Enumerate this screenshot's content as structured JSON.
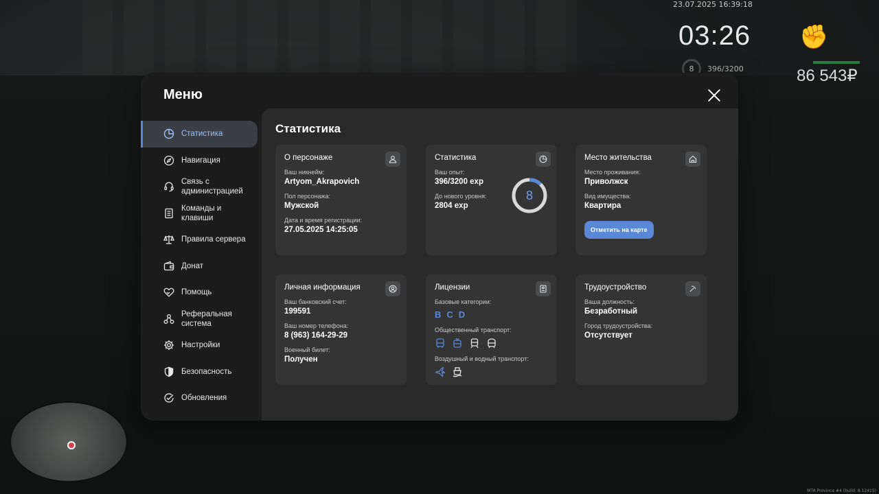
{
  "hud": {
    "datetime": "23.07.2025 16:39:18",
    "clock": "03:26",
    "level": "8",
    "exp": "396/3200",
    "money": "86 543₽",
    "build": "MTA Province #4 (build: 8.12415)"
  },
  "menu": {
    "title": "Меню",
    "sidebar": [
      {
        "label": "Статистика",
        "icon": "pie-chart-icon",
        "active": true
      },
      {
        "label": "Навигация",
        "icon": "compass-icon"
      },
      {
        "label": "Связь с администрацией",
        "icon": "headset-icon"
      },
      {
        "label": "Команды и клавиши",
        "icon": "document-icon"
      },
      {
        "label": "Правила сервера",
        "icon": "scales-icon"
      },
      {
        "label": "Донат",
        "icon": "wallet-icon"
      },
      {
        "label": "Помощь",
        "icon": "handshake-heart-icon"
      },
      {
        "label": "Реферальная система",
        "icon": "network-icon"
      },
      {
        "label": "Настройки",
        "icon": "gear-icon"
      },
      {
        "label": "Безопасность",
        "icon": "shield-icon"
      },
      {
        "label": "Обновления",
        "icon": "check-circle-icon"
      }
    ]
  },
  "content": {
    "title": "Статистика",
    "character": {
      "title": "О персонаже",
      "nickname_label": "Ваш никнейм:",
      "nickname": "Artyom_Akrapovich",
      "gender_label": "Пол персонажа:",
      "gender": "Мужской",
      "reg_label": "Дата и время регистрации:",
      "reg": "27.05.2025 14:25:05"
    },
    "stats": {
      "title": "Статистика",
      "exp_label": "Ваш опыт:",
      "exp": "396/3200 exp",
      "next_label": "До нового уровня:",
      "next": "2804 exp",
      "level": "8",
      "progress": 0.124
    },
    "residence": {
      "title": "Место жительства",
      "place_label": "Место проживания:",
      "place": "Приволжск",
      "property_label": "Вид имущества:",
      "property": "Квартира",
      "button": "Отметить на карте"
    },
    "personal": {
      "title": "Личная информация",
      "bank_label": "Ваш банковский счет:",
      "bank": "199591",
      "phone_label": "Ваш номер телефона:",
      "phone": "8 (963) 164-29-29",
      "military_label": "Военный билет:",
      "military": "Получен"
    },
    "licenses": {
      "title": "Лицензии",
      "base_label": "Базовые категории:",
      "categories": [
        "B",
        "C",
        "D"
      ],
      "public_label": "Общественный транспорт:",
      "public_icons": [
        "bus-icon",
        "trolleybus-icon",
        "tram-icon",
        "metro-icon"
      ],
      "air_label": "Воздушный и водный транспорт:",
      "air_icons": [
        "plane-icon",
        "boat-icon"
      ]
    },
    "employment": {
      "title": "Трудоустройство",
      "position_label": "Ваша должность:",
      "position": "Безработный",
      "city_label": "Город трудоустройства:",
      "city": "Отсутствует"
    }
  },
  "colors": {
    "accent": "#5b88d6",
    "panel": "#1c1c1d",
    "content": "#2a2a2b",
    "card": "#343435"
  }
}
